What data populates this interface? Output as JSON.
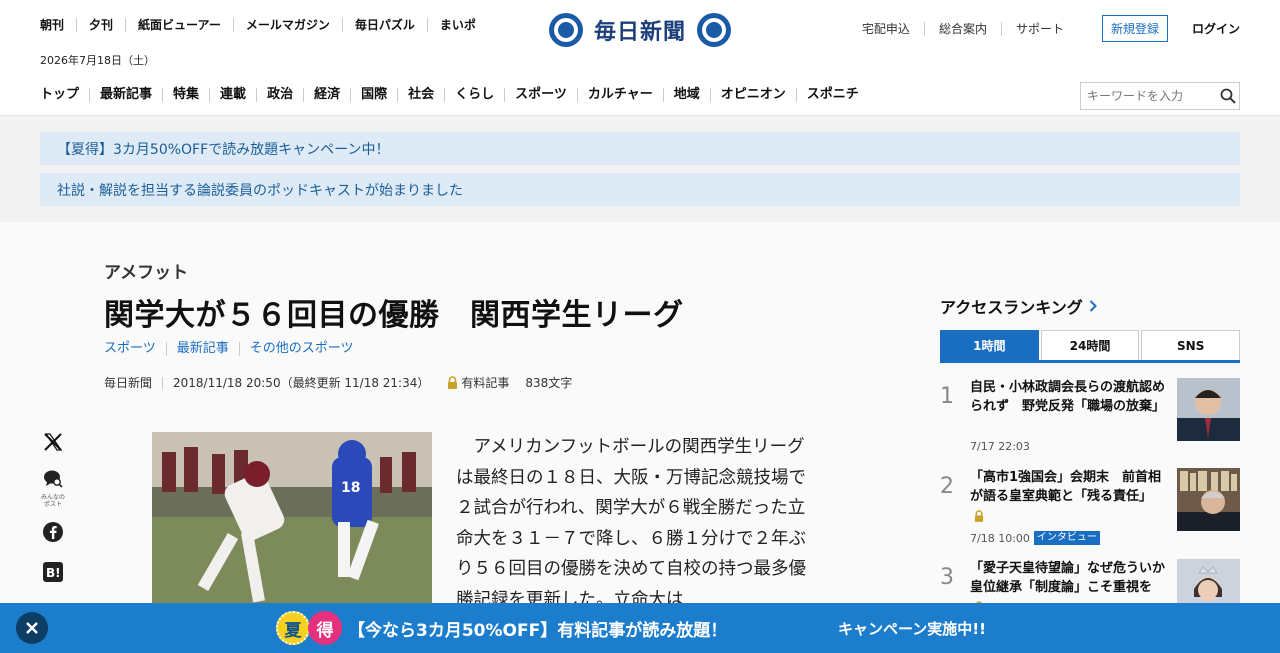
{
  "header": {
    "top_links": [
      "朝刊",
      "夕刊",
      "紙面ビューアー",
      "メールマガジン",
      "毎日パズル",
      "まいポ"
    ],
    "date": "2026年7月18日（土）",
    "logo_text": "毎日新聞",
    "right_links": [
      "宅配申込",
      "総合案内",
      "サポート"
    ],
    "register_label": "新規登録",
    "login_label": "ログイン",
    "nav": [
      "トップ",
      "最新記事",
      "特集",
      "連載",
      "政治",
      "経済",
      "国際",
      "社会",
      "くらし",
      "スポーツ",
      "カルチャー",
      "地域",
      "オピニオン",
      "スポニチ"
    ],
    "search_placeholder": "キーワードを入力",
    "search_icon": "search-icon"
  },
  "notices": [
    "【夏得】3カ月50%OFFで読み放題キャンペーン中！",
    "社説・解説を担当する論説委員のポッドキャストが始まりました"
  ],
  "article": {
    "category": "アメフット",
    "headline": "関学大が５６回目の優勝　関西学生リーグ",
    "tags": [
      "スポーツ",
      "最新記事",
      "その他のスポーツ"
    ],
    "source": "毎日新聞",
    "datetime": "2018/11/18 20:50（最終更新 11/18 21:34）",
    "paid_label": "有料記事",
    "char_count": "838文字",
    "body": "　アメリカンフットボールの関西学生リーグは最終日の１８日、大阪・万博記念競技場で２試合が行われ、関学大が６戦全勝だった立命大を３１－７で降し、６勝１分けで２年ぶり５６回目の優勝を決めて自校の持つ最多優勝記録を更新した。立命大は"
  },
  "share": {
    "post_label": "みんなのポスト",
    "icons": [
      "x-icon",
      "post-icon",
      "facebook-icon",
      "hatena-icon"
    ]
  },
  "ranking": {
    "title": "アクセスランキング",
    "tabs": [
      "1時間",
      "24時間",
      "SNS"
    ],
    "active_tab": "1時間",
    "items": [
      {
        "rank": "1",
        "title": "自民・小林政調会長らの渡航認められず　野党反発「職場の放棄」",
        "time": "7/17 22:03",
        "paid": false,
        "badge": ""
      },
      {
        "rank": "2",
        "title": "「高市1強国会」会期末　前首相が語る皇室典範と「残る責任」",
        "time": "7/18 10:00",
        "paid": true,
        "badge": "インタビュー"
      },
      {
        "rank": "3",
        "title": "「愛子天皇待望論」なぜ危ういか　皇位継承「制度論」こそ重視を",
        "time": "",
        "paid": true,
        "badge": ""
      }
    ]
  },
  "banner": {
    "badge1": "夏",
    "badge2": "得",
    "message": "【今なら3カ月50%OFF】有料記事が読み放題！",
    "cta": "キャンペーン実施中!!"
  },
  "colors": {
    "accent": "#1a6ec2",
    "notice_bg": "#deebf6",
    "banner_bg": "#1c7dcd"
  }
}
